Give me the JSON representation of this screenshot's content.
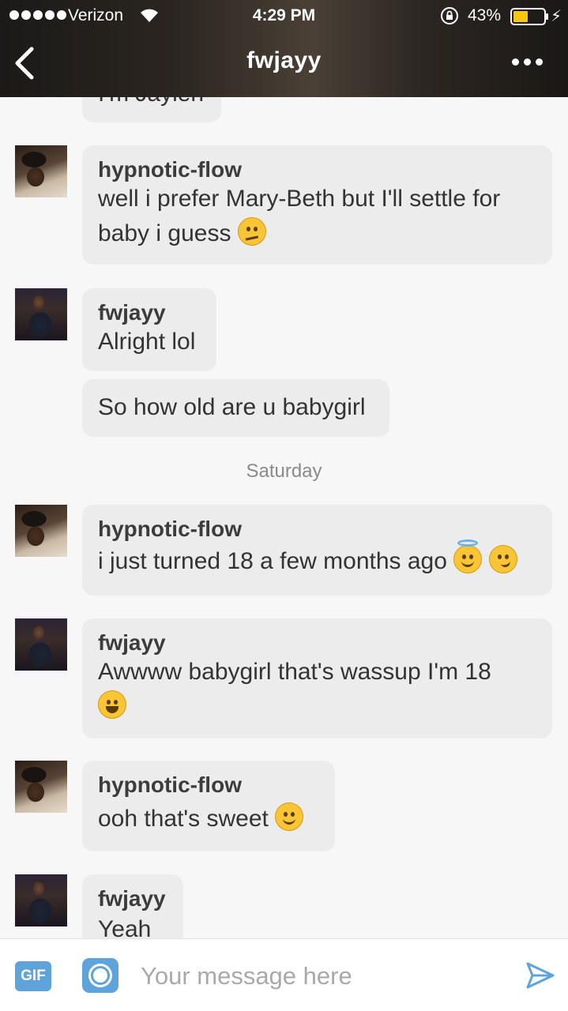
{
  "status_bar": {
    "carrier": "Verizon",
    "time": "4:29 PM",
    "battery": "43%"
  },
  "nav": {
    "title": "fwjayy"
  },
  "messages": [
    {
      "text": "I'm Jaylen"
    },
    {
      "sender": "hypnotic-flow",
      "text": "well i prefer Mary-Beth but I'll settle for baby i guess"
    },
    {
      "sender": "fwjayy",
      "text": "Alright lol"
    },
    {
      "text": "So how old are u babygirl"
    },
    {
      "sender": "hypnotic-flow",
      "text": "i just turned 18 a few months ago"
    },
    {
      "sender": "fwjayy",
      "text": "Awwww babygirl that's wassup I'm 18"
    },
    {
      "sender": "hypnotic-flow",
      "text": "ooh that's sweet"
    },
    {
      "sender": "fwjayy",
      "text": "Yeah"
    }
  ],
  "day_separator": "Saturday",
  "composer": {
    "gif_label": "GIF",
    "placeholder": "Your message here"
  },
  "icons": {
    "back": "chevron-left-icon",
    "more": "ellipsis-icon",
    "gif": "gif-icon",
    "camera": "camera-icon",
    "send": "paper-plane-icon",
    "emojis": [
      "thinking-face",
      "smiling-face-with-halo",
      "smirking-face",
      "grinning-face",
      "smiling-face-with-smiling-eyes"
    ]
  },
  "colors": {
    "accent": "#5ea3d9",
    "bubble": "#ececec",
    "background": "#f7f7f7"
  }
}
